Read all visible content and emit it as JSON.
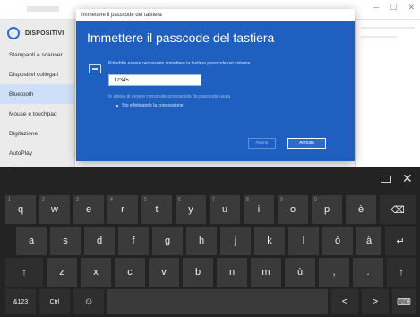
{
  "settings": {
    "section_title": "DISPOSITIVI",
    "sidebar": [
      {
        "label": "Stampanti e scanner"
      },
      {
        "label": "Dispositivi collegati"
      },
      {
        "label": "Bluetooth"
      },
      {
        "label": "Mouse e touchpad"
      },
      {
        "label": "Digitazione"
      },
      {
        "label": "AutoPlay"
      },
      {
        "label": "USB"
      }
    ],
    "active_item": "Bluetooth"
  },
  "dialog": {
    "window_title": "Immettere il passcode del tastiera",
    "heading": "Immettere il passcode del tastiera",
    "description": "Potrebbe essere necessario immettere la tastiera passcode nel sistema",
    "passcode_value": "12345",
    "hint": "In attesa di essere convocate sconosciute da passcode usata",
    "progress": "Sto effettuando la connessione",
    "ok_label": "Avanti",
    "cancel_label": "Annulla"
  },
  "keyboard": {
    "close_glyph": "✕",
    "rows": [
      [
        "q",
        "w",
        "e",
        "r",
        "t",
        "y",
        "u",
        "i",
        "o",
        "p",
        "è",
        "⌫"
      ],
      [
        "a",
        "s",
        "d",
        "f",
        "g",
        "h",
        "j",
        "k",
        "l",
        "ò",
        "à",
        "↵"
      ],
      [
        "↑",
        "z",
        "x",
        "c",
        "v",
        "b",
        "n",
        "m",
        "ù",
        ",",
        ".",
        "↑"
      ],
      [
        "&123",
        "Ctrl",
        "☺"
      ]
    ],
    "row1_sub": [
      "1",
      "2",
      "3",
      "4",
      "5",
      "6",
      "7",
      "8",
      "9",
      "0",
      "",
      ""
    ],
    "nav": [
      "<",
      ">",
      "⌨"
    ]
  },
  "colors": {
    "dialog_blue": "#1f5fbf",
    "keyboard_bg": "#232323",
    "key_bg": "#3a3a3a",
    "sidebar_active": "#cde0f7"
  },
  "icons": {
    "settings": "gear-icon",
    "keyboard_close": "close-icon",
    "keyboard_layout": "keyboard-icon",
    "backspace": "backspace-icon",
    "enter": "enter-icon",
    "shift": "shift-icon",
    "emoji": "emoji-icon"
  }
}
